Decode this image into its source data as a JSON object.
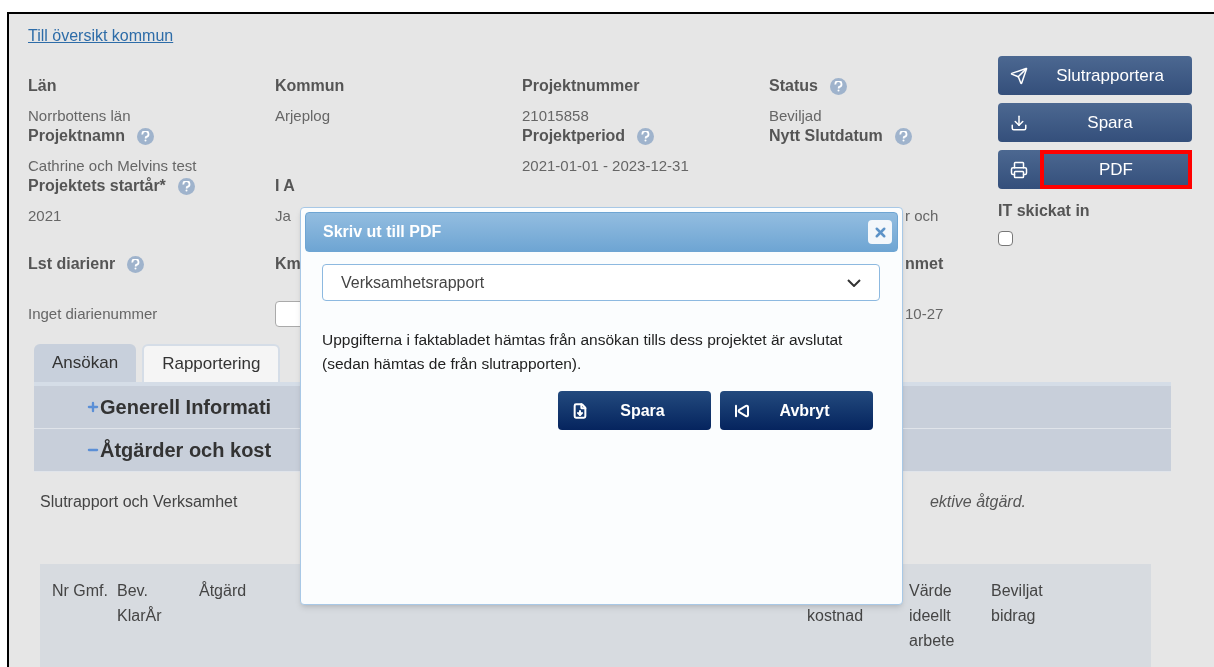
{
  "back_link": "Till översikt kommun",
  "fields": [
    {
      "label": "Län",
      "value": "Norrbottens län",
      "help": false
    },
    {
      "label": "Kommun",
      "value": "Arjeplog",
      "help": false
    },
    {
      "label": "Projektnummer",
      "value": "21015858",
      "help": false
    },
    {
      "label": "Status",
      "value": "Beviljad",
      "help": true
    },
    {
      "label": "Projektnamn",
      "value": "Cathrine och Melvins test",
      "help": true
    },
    {
      "label": "Projektperiod",
      "value": "2021-01-01 - 2023-12-31",
      "help": true
    },
    {
      "label": "Nytt Slutdatum",
      "help": true
    },
    {
      "label": "Projektets startår*",
      "value": "2021",
      "help": true
    },
    {
      "label": "I A",
      "value": "Ja",
      "help": false
    },
    {
      "value": "r och",
      "help": false
    },
    {
      "label": "Lst diarienr",
      "value": "Inget diarienummer",
      "help": true
    },
    {
      "label": "Km",
      "help": false
    },
    {
      "label": "nmet",
      "value": "10-27",
      "help": false
    }
  ],
  "actions": [
    {
      "label": "Slutrapportera",
      "highlighted": false
    },
    {
      "label": "Spara",
      "highlighted": false
    },
    {
      "label": "PDF",
      "highlighted": true
    }
  ],
  "it_submitted": {
    "label": "IT skickat in",
    "checked": false
  },
  "tabs": [
    {
      "label": "Ansökan",
      "selected": true
    },
    {
      "label": "Rapportering",
      "selected": false
    }
  ],
  "sections": [
    {
      "label": "Generell Informati",
      "expanded": false
    },
    {
      "label": "Åtgärder och kost",
      "expanded": true
    }
  ],
  "note": {
    "start": "Slutrapport och Verksamhet",
    "end": "ektive åtgärd."
  },
  "table": {
    "columns": [
      {
        "label": "Nr Gmf."
      },
      {
        "label": "Bev. KlarÅr"
      },
      {
        "label": "Åtgärd"
      },
      {
        "label": "kostnad"
      },
      {
        "label": "Värde ideellt arbete"
      },
      {
        "label": "Beviljat bidrag"
      }
    ]
  },
  "dialog": {
    "title": "Skriv ut till PDF",
    "select_value": "Verksamhetsrapport",
    "text": "Uppgifterna i faktabladet hämtas från ansökan tills dess projektet är avslutat (sedan hämtas de från slutrapporten).",
    "buttons": [
      {
        "label": "Spara"
      },
      {
        "label": "Avbryt"
      }
    ]
  }
}
